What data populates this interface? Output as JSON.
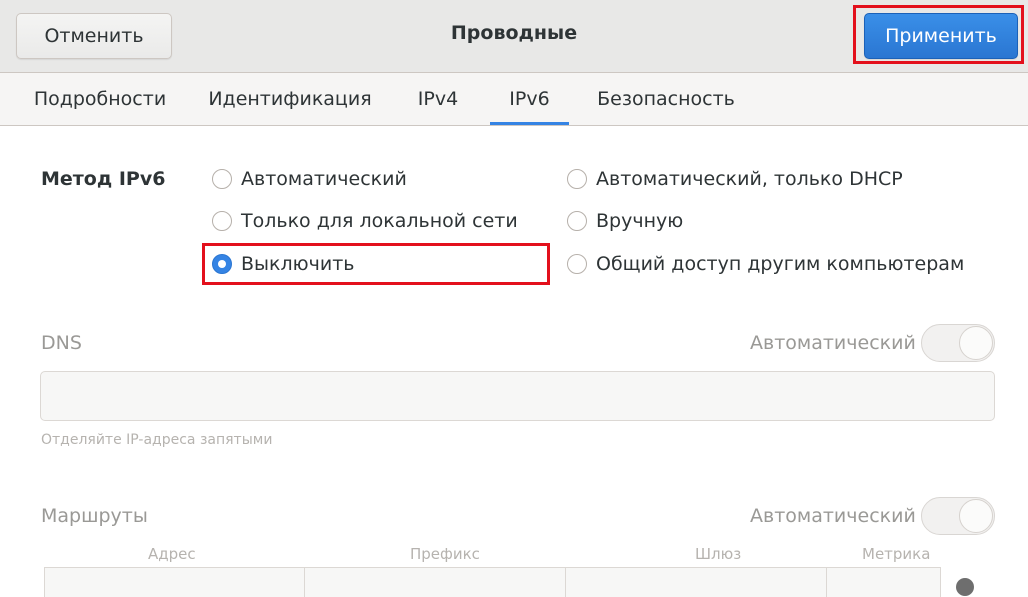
{
  "header": {
    "cancel_label": "Отменить",
    "title": "Проводные",
    "apply_label": "Применить"
  },
  "tabs": [
    {
      "label": "Подробности"
    },
    {
      "label": "Идентификация"
    },
    {
      "label": "IPv4"
    },
    {
      "label": "IPv6",
      "active": true
    },
    {
      "label": "Безопасность"
    }
  ],
  "ipv6_method": {
    "label": "Метод IPv6",
    "options": [
      {
        "label": "Автоматический",
        "checked": false
      },
      {
        "label": "Автоматический, только DHCP",
        "checked": false
      },
      {
        "label": "Только для локальной сети",
        "checked": false
      },
      {
        "label": "Вручную",
        "checked": false
      },
      {
        "label": "Выключить",
        "checked": true
      },
      {
        "label": "Общий доступ другим компьютерам",
        "checked": false
      }
    ]
  },
  "dns": {
    "title": "DNS",
    "auto_label": "Автоматический",
    "auto_enabled": true,
    "value": "",
    "hint": "Отделяйте IP-адреса запятыми"
  },
  "routes": {
    "title": "Маршруты",
    "auto_label": "Автоматический",
    "auto_enabled": true,
    "columns": [
      "Адрес",
      "Префикс",
      "Шлюз",
      "Метрика"
    ]
  },
  "colors": {
    "accent": "#3584e4",
    "highlight": "#e3101c"
  }
}
